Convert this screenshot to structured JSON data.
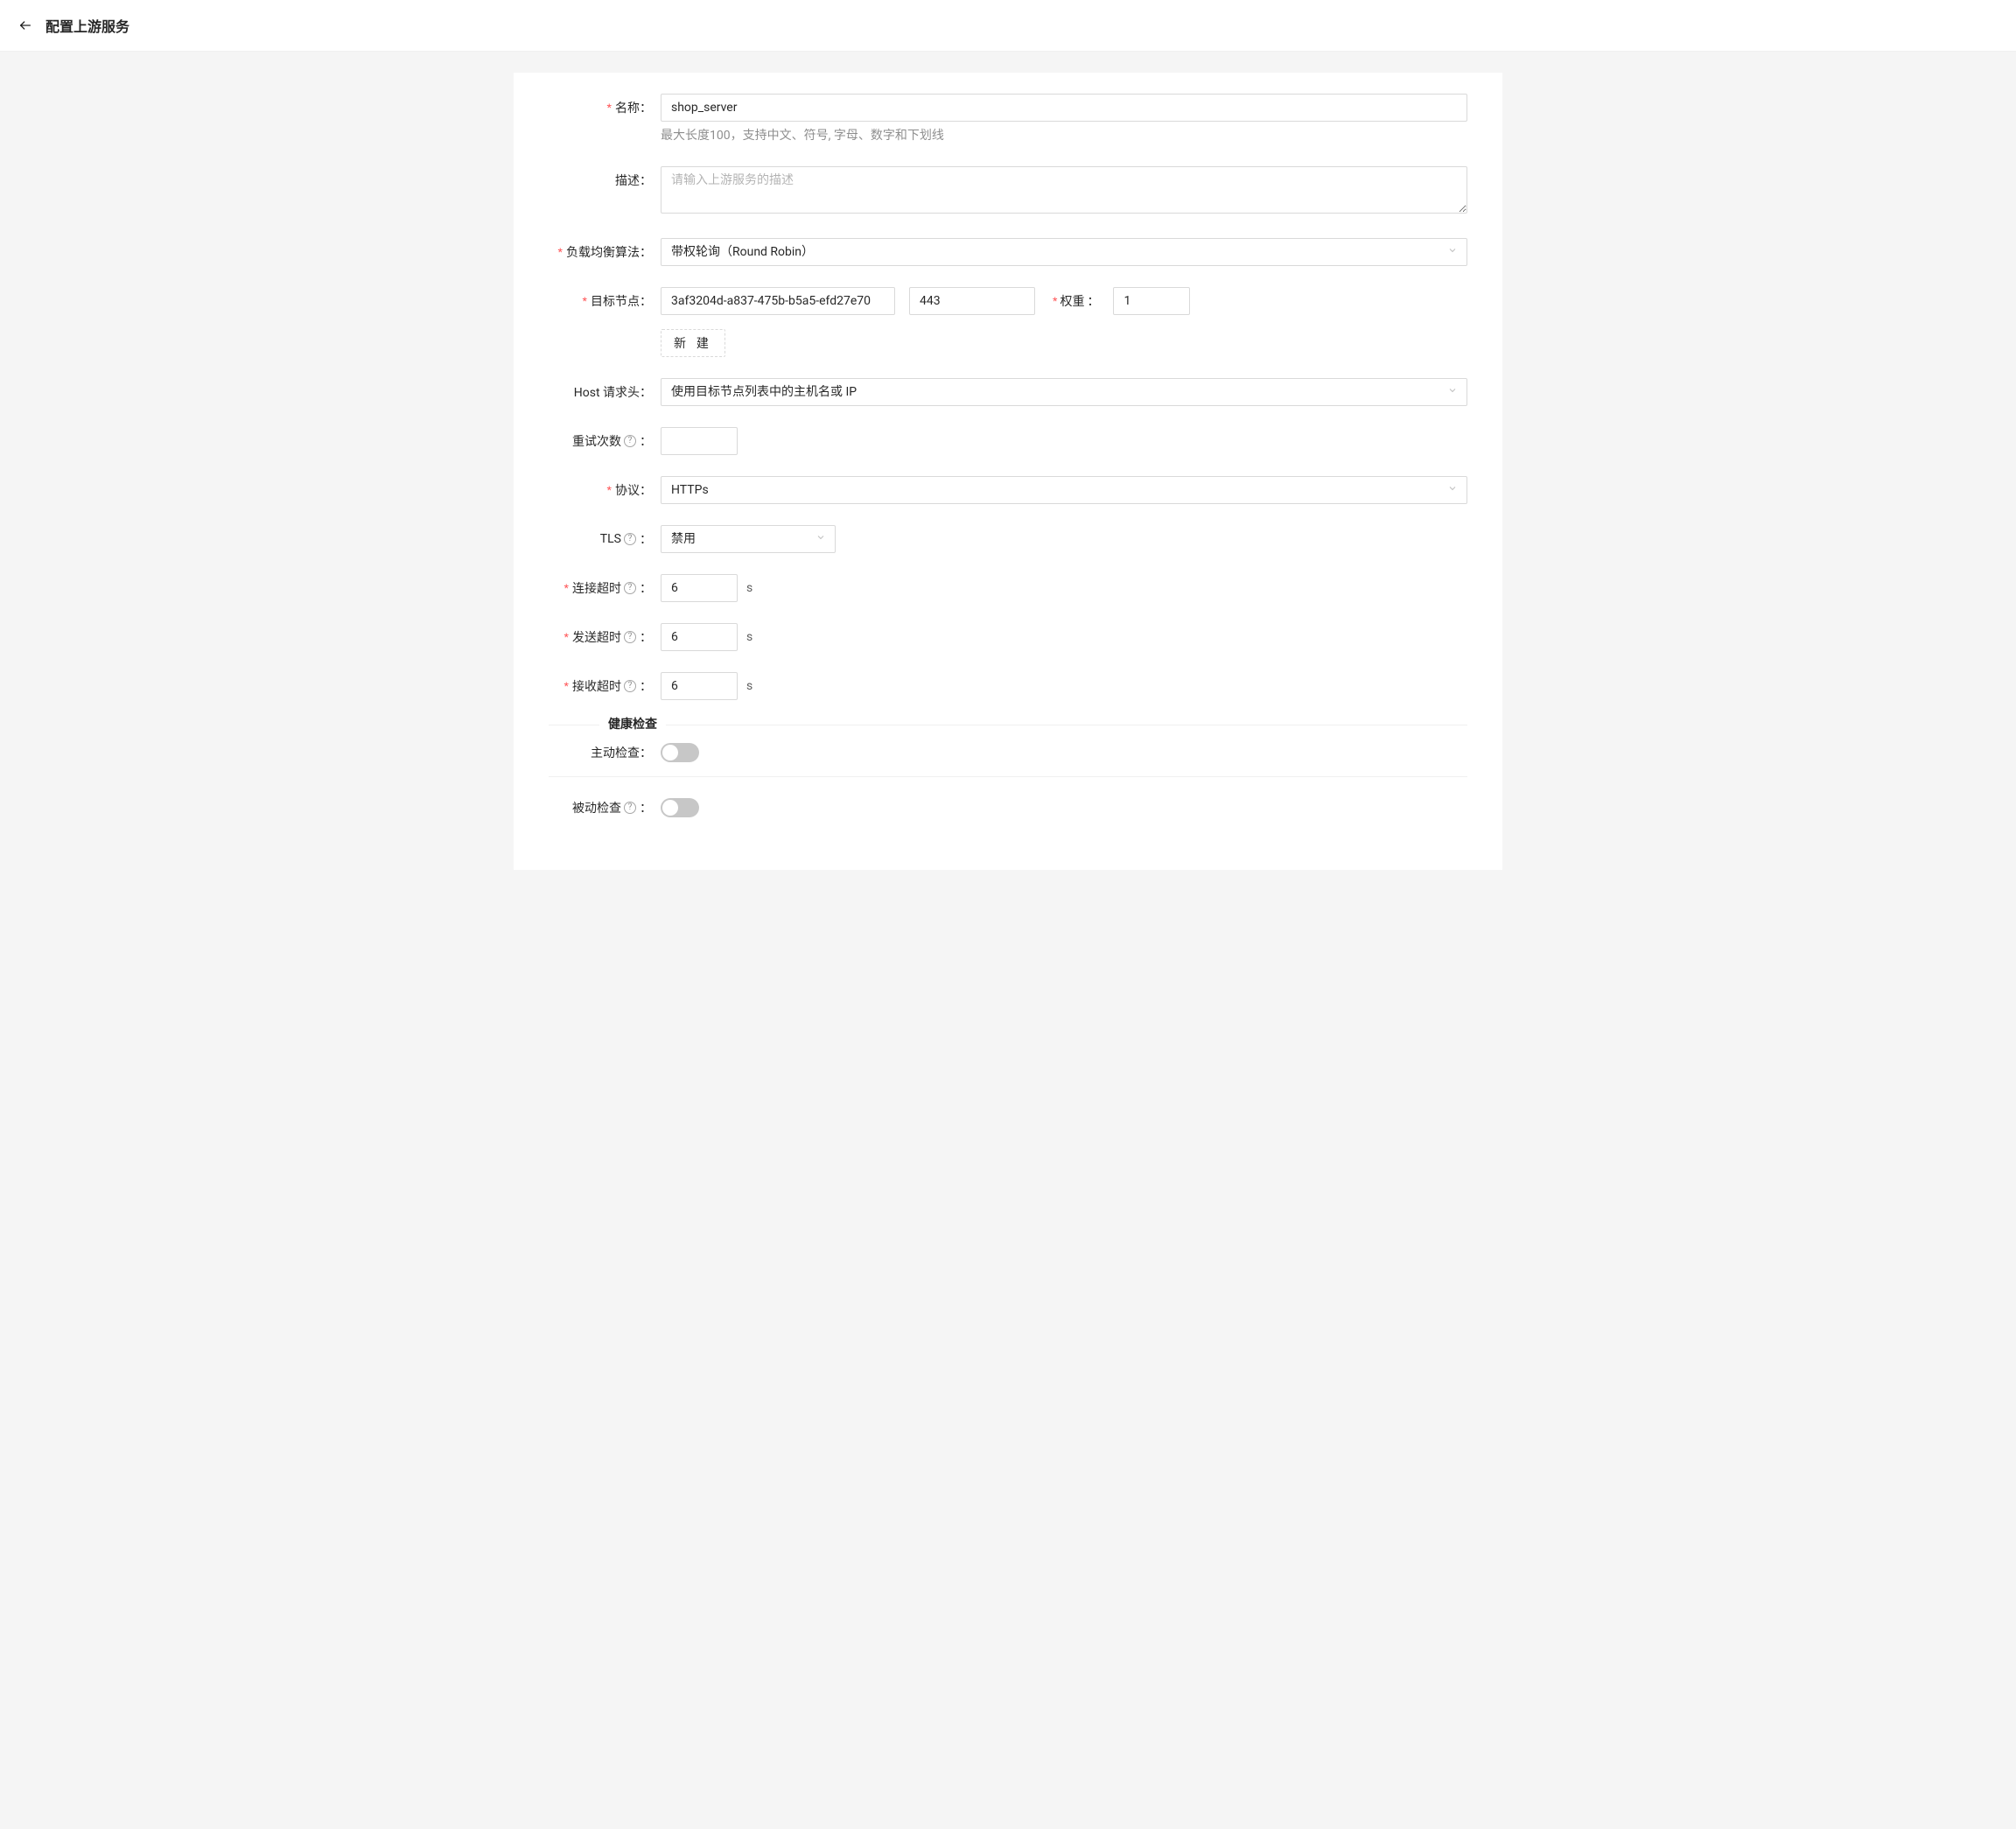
{
  "header": {
    "title": "配置上游服务"
  },
  "labels": {
    "name": "名称",
    "description": "描述",
    "lb_algo": "负载均衡算法",
    "target": "目标节点",
    "weight": "权重",
    "host_header": "Host 请求头",
    "retries": "重试次数",
    "protocol": "协议",
    "tls": "TLS",
    "connect_timeout": "连接超时",
    "send_timeout": "发送超时",
    "recv_timeout": "接收超时",
    "active_check": "主动检查",
    "passive_check": "被动检查"
  },
  "values": {
    "name": "shop_server",
    "name_help": "最大长度100，支持中文、符号, 字母、数字和下划线",
    "description": "",
    "description_placeholder": "请输入上游服务的描述",
    "lb_algo": "带权轮询（Round Robin）",
    "target_host": "3af3204d-a837-475b-b5a5-efd27e70",
    "target_port": "443",
    "target_weight": "1",
    "new_button": "新 建",
    "host_header": "使用目标节点列表中的主机名或 IP",
    "retries": "",
    "protocol": "HTTPs",
    "tls": "禁用",
    "connect_timeout": "6",
    "send_timeout": "6",
    "recv_timeout": "6",
    "timeout_unit": "s",
    "active_check_on": false,
    "passive_check_on": false
  },
  "section": {
    "health_check": "健康检查"
  },
  "punct": {
    "colon": "："
  }
}
